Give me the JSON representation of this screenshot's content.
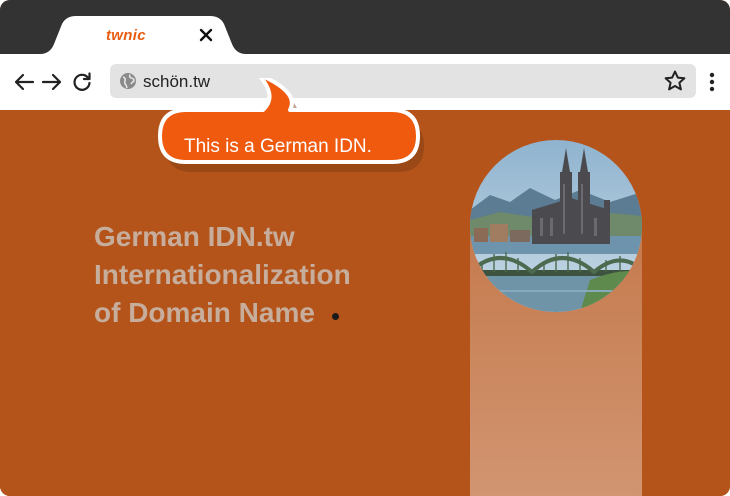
{
  "browser": {
    "tab": {
      "logo_text": "twnic"
    },
    "address_bar": {
      "url": "schön.tw"
    }
  },
  "page": {
    "callout": {
      "text": "This is a German IDN."
    },
    "headline": {
      "line1": "German IDN.tw",
      "line2": "Internationalization",
      "line3": "of Domain Name"
    }
  },
  "colors": {
    "page_background": "#b5541a",
    "callout_fill": "#f05a0f",
    "brand_logo": "#e85d12",
    "headline_text": "#c6ad9c"
  },
  "icons": {
    "tab": [
      "close-icon"
    ],
    "toolbar": [
      "back-arrow-icon",
      "forward-arrow-icon",
      "reload-icon",
      "globe-icon",
      "star-icon",
      "more-vert-icon"
    ]
  }
}
